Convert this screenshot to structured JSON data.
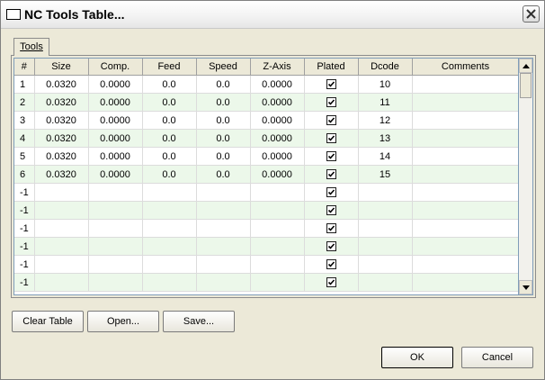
{
  "window": {
    "title": "NC Tools Table..."
  },
  "tabs": [
    {
      "label": "Tools"
    }
  ],
  "table": {
    "columns": [
      "#",
      "Size",
      "Comp.",
      "Feed",
      "Speed",
      "Z-Axis",
      "Plated",
      "Dcode",
      "Comments"
    ],
    "rows": [
      {
        "num": "1",
        "size": "0.0320",
        "comp": "0.0000",
        "feed": "0.0",
        "speed": "0.0",
        "zaxis": "0.0000",
        "plated": true,
        "dcode": "10",
        "comments": ""
      },
      {
        "num": "2",
        "size": "0.0320",
        "comp": "0.0000",
        "feed": "0.0",
        "speed": "0.0",
        "zaxis": "0.0000",
        "plated": true,
        "dcode": "11",
        "comments": ""
      },
      {
        "num": "3",
        "size": "0.0320",
        "comp": "0.0000",
        "feed": "0.0",
        "speed": "0.0",
        "zaxis": "0.0000",
        "plated": true,
        "dcode": "12",
        "comments": ""
      },
      {
        "num": "4",
        "size": "0.0320",
        "comp": "0.0000",
        "feed": "0.0",
        "speed": "0.0",
        "zaxis": "0.0000",
        "plated": true,
        "dcode": "13",
        "comments": ""
      },
      {
        "num": "5",
        "size": "0.0320",
        "comp": "0.0000",
        "feed": "0.0",
        "speed": "0.0",
        "zaxis": "0.0000",
        "plated": true,
        "dcode": "14",
        "comments": ""
      },
      {
        "num": "6",
        "size": "0.0320",
        "comp": "0.0000",
        "feed": "0.0",
        "speed": "0.0",
        "zaxis": "0.0000",
        "plated": true,
        "dcode": "15",
        "comments": ""
      },
      {
        "num": "-1",
        "size": "",
        "comp": "",
        "feed": "",
        "speed": "",
        "zaxis": "",
        "plated": true,
        "dcode": "",
        "comments": ""
      },
      {
        "num": "-1",
        "size": "",
        "comp": "",
        "feed": "",
        "speed": "",
        "zaxis": "",
        "plated": true,
        "dcode": "",
        "comments": ""
      },
      {
        "num": "-1",
        "size": "",
        "comp": "",
        "feed": "",
        "speed": "",
        "zaxis": "",
        "plated": true,
        "dcode": "",
        "comments": ""
      },
      {
        "num": "-1",
        "size": "",
        "comp": "",
        "feed": "",
        "speed": "",
        "zaxis": "",
        "plated": true,
        "dcode": "",
        "comments": ""
      },
      {
        "num": "-1",
        "size": "",
        "comp": "",
        "feed": "",
        "speed": "",
        "zaxis": "",
        "plated": true,
        "dcode": "",
        "comments": ""
      },
      {
        "num": "-1",
        "size": "",
        "comp": "",
        "feed": "",
        "speed": "",
        "zaxis": "",
        "plated": true,
        "dcode": "",
        "comments": ""
      }
    ]
  },
  "buttons": {
    "clear_table": "Clear Table",
    "open": "Open...",
    "save": "Save...",
    "ok": "OK",
    "cancel": "Cancel"
  },
  "icons": {
    "close": "close-icon",
    "check": "checkmark-icon",
    "scroll_up": "arrow-up-icon",
    "scroll_down": "arrow-down-icon"
  },
  "colors": {
    "alt_row": "#ecf8ea",
    "dialog_bg": "#ece9d8"
  }
}
